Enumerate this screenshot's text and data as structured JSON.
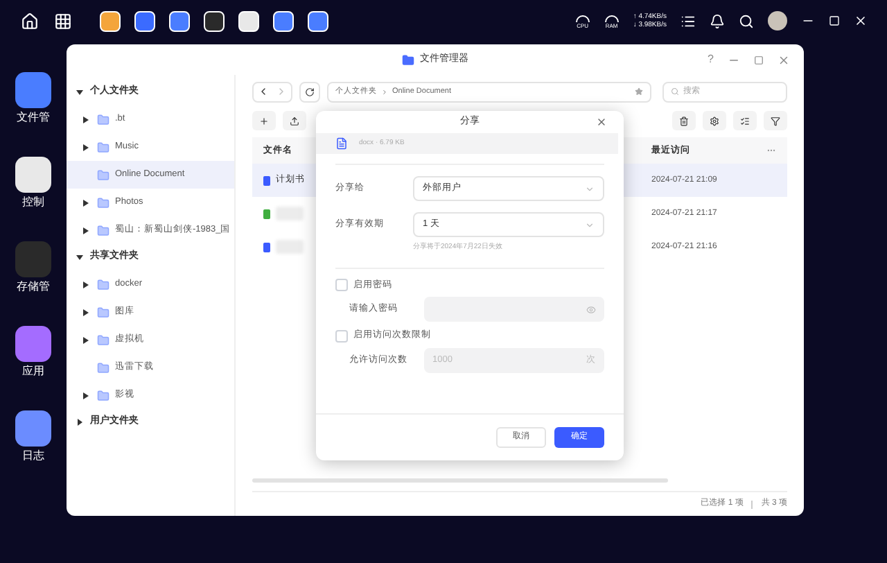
{
  "top_bar": {
    "cpu_label": "CPU",
    "ram_label": "RAM",
    "upload_speed": "↑ 4.74KB/s",
    "download_speed": "↓ 3.98KB/s"
  },
  "desktop_icons": [
    {
      "label": "文件管"
    },
    {
      "label": "控制"
    },
    {
      "label": "存储管"
    },
    {
      "label": "应用"
    },
    {
      "label": "日志"
    }
  ],
  "window": {
    "title": "文件管理器",
    "help": "?"
  },
  "sidebar": {
    "groups": [
      {
        "label": "个人文件夹",
        "expanded": true,
        "items": [
          {
            "label": ".bt",
            "has_children": true,
            "selected": false
          },
          {
            "label": "Music",
            "has_children": true,
            "selected": false
          },
          {
            "label": "Online Document",
            "has_children": false,
            "selected": true
          },
          {
            "label": "Photos",
            "has_children": true,
            "selected": false
          },
          {
            "label": "蜀山：新蜀山剑侠-1983_国",
            "has_children": true,
            "selected": false
          }
        ]
      },
      {
        "label": "共享文件夹",
        "expanded": true,
        "items": [
          {
            "label": "docker",
            "has_children": true,
            "selected": false
          },
          {
            "label": "图库",
            "has_children": true,
            "selected": false
          },
          {
            "label": "虚拟机",
            "has_children": true,
            "selected": false
          },
          {
            "label": "迅雷下载",
            "has_children": false,
            "selected": false
          },
          {
            "label": "影视",
            "has_children": true,
            "selected": false
          }
        ]
      },
      {
        "label": "用户文件夹",
        "expanded": false
      }
    ]
  },
  "path": [
    "个人文件夹",
    "Online Document"
  ],
  "search": {
    "placeholder": "搜索"
  },
  "table": {
    "columns": [
      "文件名",
      "最近访问"
    ],
    "rows": [
      {
        "name": "计划书",
        "name_blurred": false,
        "last_access": "2024-07-21 21:09",
        "selected": true,
        "color": "#3b5bff"
      },
      {
        "name": "",
        "name_blurred": true,
        "last_access": "2024-07-21 21:17",
        "selected": false,
        "color": "#3fae3f"
      },
      {
        "name": "",
        "name_blurred": true,
        "last_access": "2024-07-21 21:16",
        "selected": false,
        "color": "#3b5bff"
      }
    ]
  },
  "status_bar": {
    "selected": "已选择 1 项",
    "total": "共 3 项"
  },
  "dialog": {
    "title": "分享",
    "file_meta": "docx · 6.79 KB",
    "share_to": {
      "label": "分享给",
      "value": "外部用户"
    },
    "validity": {
      "label": "分享有效期",
      "value": "1 天",
      "hint": "分享将于2024年7月22日失效"
    },
    "password": {
      "checkbox": "启用密码",
      "checked": false,
      "label": "请输入密码"
    },
    "limit": {
      "checkbox": "启用访问次数限制",
      "checked": false,
      "label": "允许访问次数",
      "placeholder": "1000",
      "unit": "次"
    },
    "buttons": [
      {
        "label": "取消",
        "kind": "secondary"
      },
      {
        "label": "确定",
        "kind": "primary"
      }
    ]
  }
}
